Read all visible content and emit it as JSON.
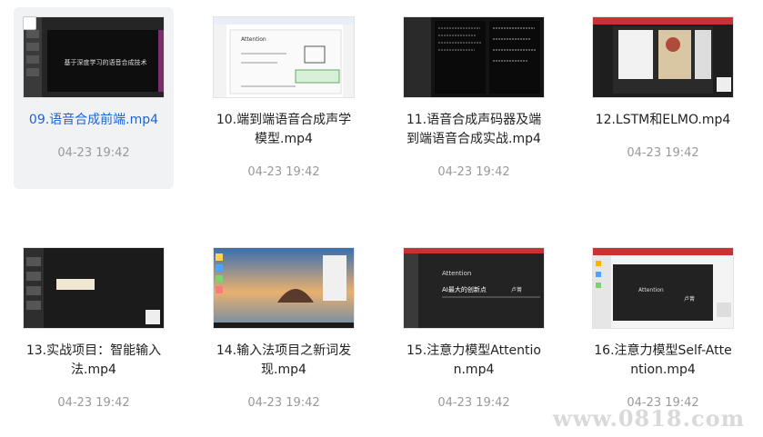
{
  "items": [
    {
      "title_lines": [
        "09.语音合成前端.mp4"
      ],
      "date": "04-23 19:42"
    },
    {
      "title_lines": [
        "10.端到端语音合成声学",
        "模型.mp4"
      ],
      "date": "04-23 19:42"
    },
    {
      "title_lines": [
        "11.语音合成声码器及端",
        "到端语音合成实战.mp4"
      ],
      "date": "04-23 19:42"
    },
    {
      "title_lines": [
        "12.LSTM和ELMO.mp4"
      ],
      "date": "04-23 19:42"
    },
    {
      "title_lines": [
        "13.实战项目：智能输入",
        "法.mp4"
      ],
      "date": "04-23 19:42"
    },
    {
      "title_lines": [
        "14.输入法项目之新词发",
        "现.mp4"
      ],
      "date": "04-23 19:42"
    },
    {
      "title_lines": [
        "15.注意力模型Attentio",
        "n.mp4"
      ],
      "date": "04-23 19:42"
    },
    {
      "title_lines": [
        "16.注意力模型Self-Atte",
        "ntion.mp4"
      ],
      "date": "04-23 19:42"
    }
  ],
  "thumb_text": {
    "t09": "基于深度学习的语音合成技术",
    "t10": "Attention",
    "t15_line1": "Attention",
    "t15_line2": "AI最大的创新点",
    "t15_badge": "卢菁",
    "t16_line1": "Attention",
    "t16_badge": "卢菁"
  },
  "watermark": "www.0818.com"
}
